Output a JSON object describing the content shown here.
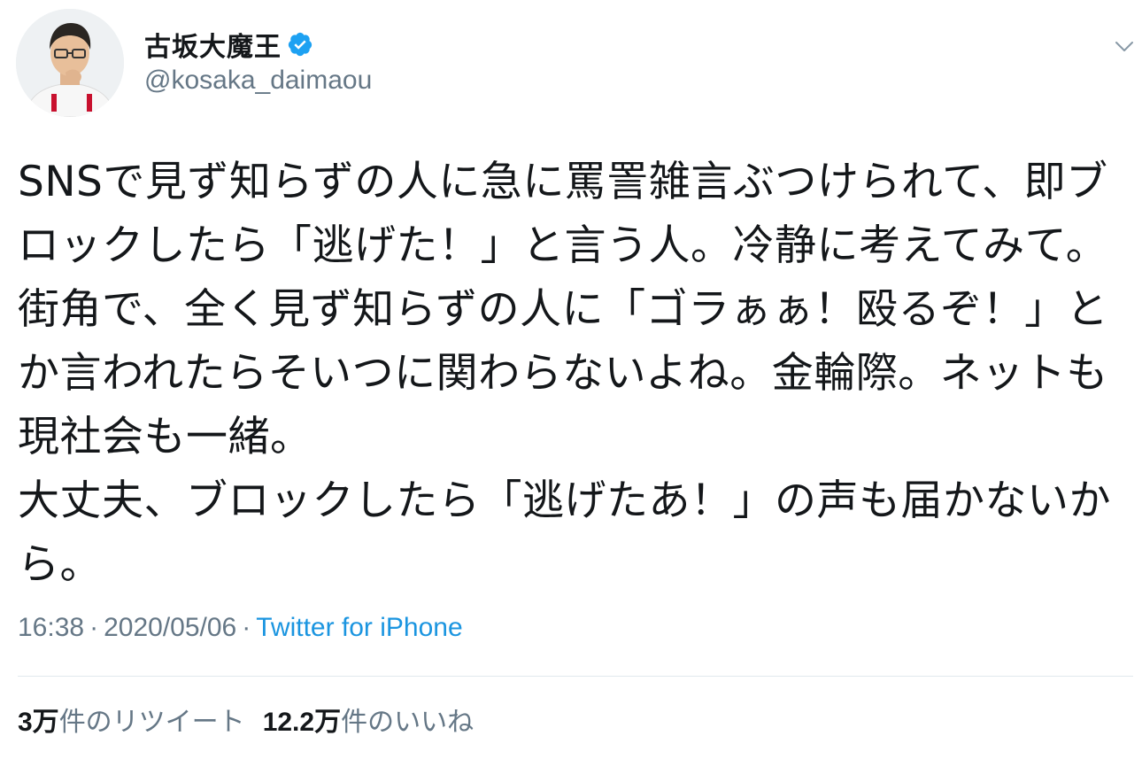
{
  "user": {
    "display_name": "古坂大魔王",
    "handle": "@kosaka_daimaou",
    "verified": true
  },
  "tweet": {
    "text": "SNSで見ず知らずの人に急に罵詈雑言ぶつけられて、即ブロックしたら「逃げた！」と言う人。冷静に考えてみて。\n街角で、全く見ず知らずの人に「ゴラぁぁ！殴るぞ！」とか言われたらそいつに関わらないよね。金輪際。ネットも現社会も一緒。\n大丈夫、ブロックしたら「逃げたあ！」の声も届かないから。",
    "time": "16:38",
    "separator": "·",
    "date": "2020/05/06",
    "source": "Twitter for iPhone"
  },
  "stats": {
    "retweets_count": "3万",
    "retweets_label": "件のリツイート",
    "likes_count": "12.2万",
    "likes_label": "件のいいね"
  },
  "icons": {
    "verified": "verified-badge-icon",
    "caret": "chevron-down-icon"
  },
  "colors": {
    "text": "#14171a",
    "secondary": "#657786",
    "link": "#1b95e0",
    "verified": "#1da1f2",
    "divider": "#e1e8ed"
  }
}
